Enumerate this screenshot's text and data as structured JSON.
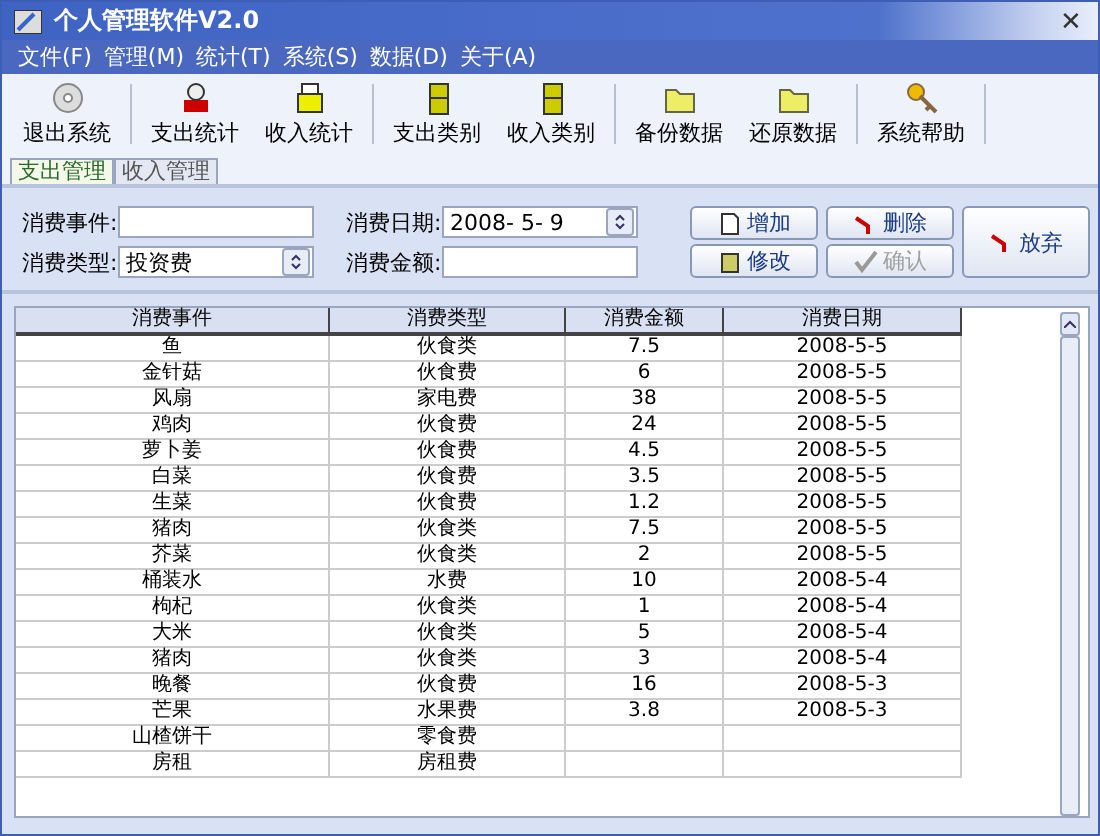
{
  "window": {
    "title": "个人管理软件V2.0",
    "close": "✕"
  },
  "menu": [
    "文件(F)",
    "管理(M)",
    "统计(T)",
    "系统(S)",
    "数据(D)",
    "关于(A)"
  ],
  "toolbar": [
    {
      "label": "退出系统",
      "kind": "disc"
    },
    {
      "label": "支出统计",
      "kind": "stamp"
    },
    {
      "label": "收入统计",
      "kind": "printer"
    },
    {
      "label": "支出类别",
      "kind": "cabinet"
    },
    {
      "label": "收入类别",
      "kind": "cabinet"
    },
    {
      "label": "备份数据",
      "kind": "folder"
    },
    {
      "label": "还原数据",
      "kind": "folder"
    },
    {
      "label": "系统帮助",
      "kind": "key"
    }
  ],
  "tabs": [
    {
      "label": "支出管理",
      "selected": true
    },
    {
      "label": "收入管理",
      "selected": false
    }
  ],
  "form": {
    "event": {
      "label": "消费事件:"
    },
    "type": {
      "label": "消费类型:",
      "value": "投资费"
    },
    "date": {
      "label": "消费日期:",
      "value": "2008- 5- 9"
    },
    "amount": {
      "label": "消费金额:"
    }
  },
  "buttons": [
    {
      "label": "增加",
      "kind": "page",
      "disabled": false
    },
    {
      "label": "删除",
      "kind": "undo",
      "disabled": false
    },
    {
      "label": "修改",
      "kind": "edit",
      "disabled": false
    },
    {
      "label": "确认",
      "kind": "tick",
      "disabled": true
    },
    {
      "label": "放弃",
      "kind": "undo",
      "disabled": false
    }
  ],
  "table": {
    "columns": [
      "消费事件",
      "消费类型",
      "消费金额",
      "消费日期"
    ],
    "rows": [
      [
        "鱼",
        "伙食类",
        "7.5",
        "2008-5-5"
      ],
      [
        "金针菇",
        "伙食费",
        "6",
        "2008-5-5"
      ],
      [
        "风扇",
        "家电费",
        "38",
        "2008-5-5"
      ],
      [
        "鸡肉",
        "伙食费",
        "24",
        "2008-5-5"
      ],
      [
        "萝卜姜",
        "伙食费",
        "4.5",
        "2008-5-5"
      ],
      [
        "白菜",
        "伙食费",
        "3.5",
        "2008-5-5"
      ],
      [
        "生菜",
        "伙食费",
        "1.2",
        "2008-5-5"
      ],
      [
        "猪肉",
        "伙食类",
        "7.5",
        "2008-5-5"
      ],
      [
        "芥菜",
        "伙食类",
        "2",
        "2008-5-5"
      ],
      [
        "桶装水",
        "水费",
        "10",
        "2008-5-4"
      ],
      [
        "枸杞",
        "伙食类",
        "1",
        "2008-5-4"
      ],
      [
        "大米",
        "伙食类",
        "5",
        "2008-5-4"
      ],
      [
        "猪肉",
        "伙食类",
        "3",
        "2008-5-4"
      ],
      [
        "晚餐",
        "伙食费",
        "16",
        "2008-5-3"
      ],
      [
        "芒果",
        "水果费",
        "3.8",
        "2008-5-3"
      ],
      [
        "山楂饼干",
        "零食费"
      ],
      [
        "房租",
        "房租费"
      ]
    ]
  }
}
